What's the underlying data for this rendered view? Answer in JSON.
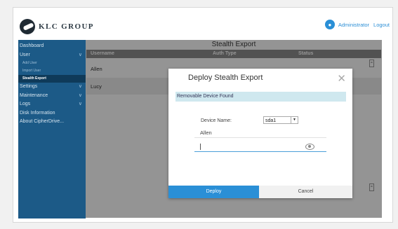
{
  "header": {
    "logo_text": "KLC GROUP",
    "user": "Administrator",
    "logout": "Logout"
  },
  "sidebar": {
    "items": [
      {
        "label": "Dashboard",
        "chevron": ""
      },
      {
        "label": "User",
        "chevron": "∨"
      },
      {
        "label": "Add User",
        "sub": true
      },
      {
        "label": "Import User",
        "sub": true
      },
      {
        "label": "Stealth Export",
        "sub": true,
        "active": true
      },
      {
        "label": "Settings",
        "chevron": "∨"
      },
      {
        "label": "Maintenance",
        "chevron": "∨"
      },
      {
        "label": "Logs",
        "chevron": "∨"
      },
      {
        "label": "Disk Information",
        "chevron": ""
      },
      {
        "label": "About CipherDrive...",
        "chevron": ""
      }
    ]
  },
  "main": {
    "title": "Stealth Export",
    "columns": [
      "Username",
      "Auth Type",
      "Status"
    ],
    "rows": [
      {
        "username": "Allen"
      },
      {
        "username": "Lucy"
      }
    ]
  },
  "dialog": {
    "title": "Deploy Stealth Export",
    "banner": "Removable Device Found",
    "device_label": "Device Name:",
    "device_value": "sda1",
    "username_value": "Allen",
    "password_value": "",
    "deploy_label": "Deploy",
    "cancel_label": "Cancel"
  },
  "colors": {
    "sidebar": "#1c5a87",
    "accent": "#2a8fd6",
    "banner": "#cfe8ef"
  }
}
